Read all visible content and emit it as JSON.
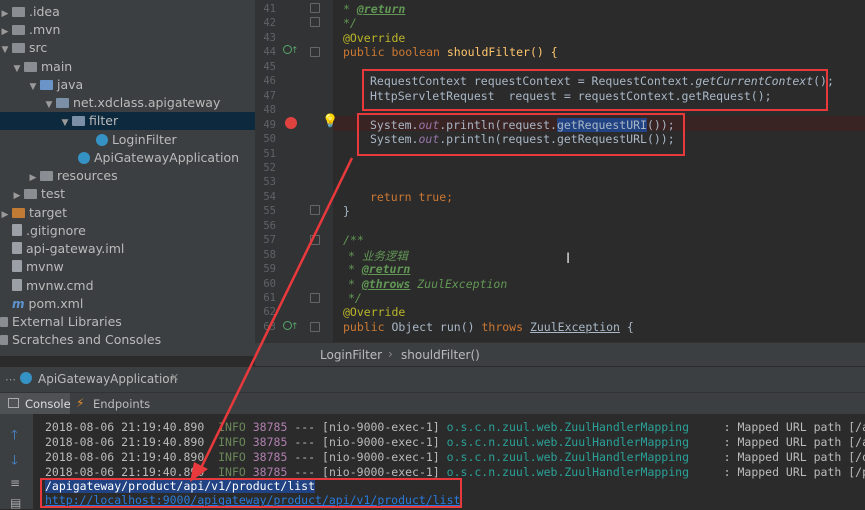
{
  "project_tree": {
    "items": [
      {
        "label": ".idea"
      },
      {
        "label": ".mvn"
      },
      {
        "label": "src"
      },
      {
        "label": "main"
      },
      {
        "label": "java"
      },
      {
        "label": "net.xdclass.apigateway"
      },
      {
        "label": "filter"
      },
      {
        "label": "LoginFilter"
      },
      {
        "label": "ApiGatewayApplication"
      },
      {
        "label": "resources"
      },
      {
        "label": "test"
      },
      {
        "label": "target"
      },
      {
        "label": ".gitignore"
      },
      {
        "label": "api-gateway.iml"
      },
      {
        "label": "mvnw"
      },
      {
        "label": "mvnw.cmd"
      },
      {
        "label": "pom.xml"
      },
      {
        "label": "External Libraries"
      },
      {
        "label": "Scratches and Consoles"
      }
    ]
  },
  "editor": {
    "line_numbers": [
      "41",
      "42",
      "43",
      "44",
      "45",
      "46",
      "47",
      "48",
      "49",
      "50",
      "51",
      "52",
      "53",
      "54",
      "55",
      "56",
      "57",
      "58",
      "59",
      "60",
      "61",
      "62",
      "63"
    ],
    "code": {
      "l41_star": "* ",
      "l41_tag": "@return",
      "l42": "*/",
      "l43": "@Override",
      "l44_kw": "public boolean ",
      "l44_rest": "shouldFilter() {",
      "l46_a": "RequestContext requestContext = RequestContext.",
      "l46_b": "getCurrentContext",
      "l46_c": "();",
      "l47": "HttpServletRequest  request = requestContext.getRequest();",
      "l49_a": "System.",
      "l49_b": "out",
      "l49_c": ".println(request.",
      "l49_d": "getRequestURI",
      "l49_e": "());",
      "l50_a": "System.",
      "l50_b": "out",
      "l50_c": ".println(request.getRequestURL());",
      "l54_kw": "return true",
      "l54_rest": ";",
      "l55": "}",
      "l57": "/**",
      "l58": "* 业务逻辑",
      "l59_star": "* ",
      "l59_tag": "@return",
      "l60_star": "* ",
      "l60_tag": "@throws",
      "l60_rest": " ZuulException",
      "l61": "*/",
      "l62": "@Override",
      "l63_kw": "public ",
      "l63_a": "Object run() ",
      "l63_kw2": "throws ",
      "l63_b": "ZuulException",
      "l63_c": " {"
    }
  },
  "breadcrumb": {
    "class_name": "LoginFilter",
    "method_name": "shouldFilter()"
  },
  "run_panel": {
    "run_tab_label": "ApiGatewayApplication",
    "console_tab": "Console",
    "endpoints_tab": "Endpoints",
    "log_lines": [
      {
        "ts": "2018-08-06 21:19:40.890",
        "level": "INFO",
        "pid": "38785",
        "sep": "---",
        "thread": "[nio-9000-exec-1]",
        "logger": "o.s.c.n.zuul.web.ZuulHandlerMapping",
        "msg": ": Mapped URL path [/api"
      },
      {
        "ts": "2018-08-06 21:19:40.890",
        "level": "INFO",
        "pid": "38785",
        "sep": "---",
        "thread": "[nio-9000-exec-1]",
        "logger": "o.s.c.n.zuul.web.ZuulHandlerMapping",
        "msg": ": Mapped URL path [/api"
      },
      {
        "ts": "2018-08-06 21:19:40.890",
        "level": "INFO",
        "pid": "38785",
        "sep": "---",
        "thread": "[nio-9000-exec-1]",
        "logger": "o.s.c.n.zuul.web.ZuulHandlerMapping",
        "msg": ": Mapped URL path [/orc"
      },
      {
        "ts": "2018-08-06 21:19:40.890",
        "level": "INFO",
        "pid": "38785",
        "sep": "---",
        "thread": "[nio-9000-exec-1]",
        "logger": "o.s.c.n.zuul.web.ZuulHandlerMapping",
        "msg": ": Mapped URL path [/prc"
      }
    ],
    "output_uri": "/apigateway/product/api/v1/product/list",
    "output_url": "http://localhost:9000/apigateway/product/api/v1/product/list"
  },
  "colors": {
    "annotation_red": "#e8393d",
    "keyword": "#cc7832",
    "selection": "#214283"
  }
}
